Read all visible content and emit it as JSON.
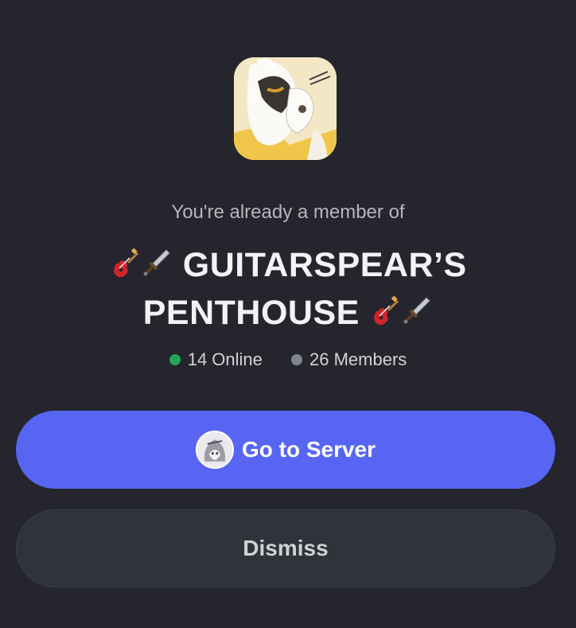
{
  "server": {
    "icon": "server-avatar-anime-character",
    "subtitle": "You're already a member of",
    "name_prefix_emoji": [
      "guitar-emoji",
      "dagger-emoji"
    ],
    "name_line1": "GUITARSPEAR’S",
    "name_line2": "PENTHOUSE",
    "name_suffix_emoji": [
      "guitar-emoji",
      "dagger-emoji"
    ]
  },
  "stats": {
    "online_label": "14 Online",
    "members_label": "26 Members",
    "online_color": "#23a55a",
    "members_color": "#80848e"
  },
  "actions": {
    "go_label": "Go to Server",
    "dismiss_label": "Dismiss"
  },
  "colors": {
    "background": "#25252d",
    "accent": "#5865f2",
    "secondary_button": "#31333b"
  }
}
